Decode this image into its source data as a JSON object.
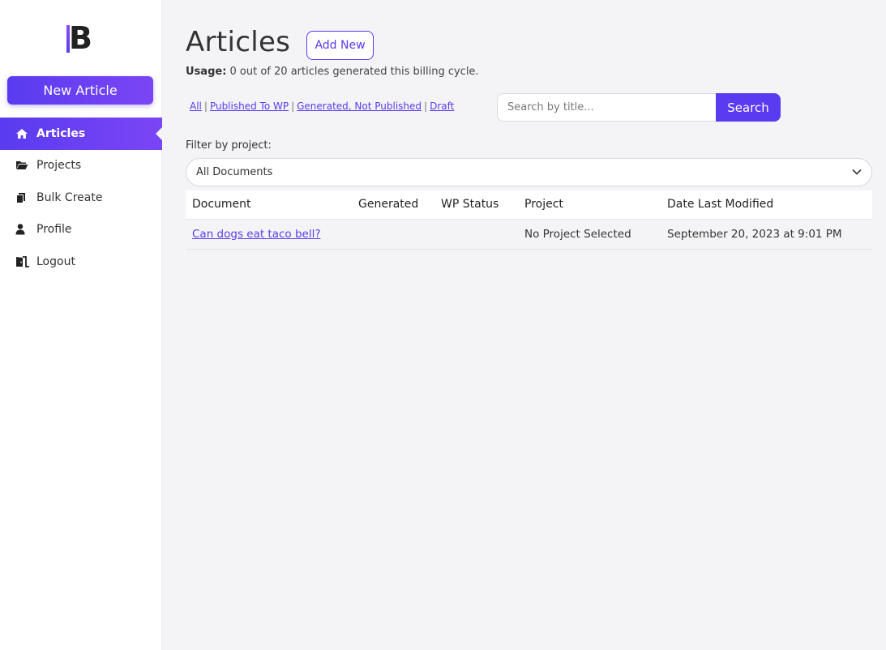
{
  "sidebar": {
    "logo_letter": "B",
    "new_article_label": "New Article",
    "items": [
      {
        "label": "Articles",
        "icon": "home-icon"
      },
      {
        "label": "Projects",
        "icon": "folder-icon"
      },
      {
        "label": "Bulk Create",
        "icon": "copy-icon"
      },
      {
        "label": "Profile",
        "icon": "user-icon"
      },
      {
        "label": "Logout",
        "icon": "door-icon"
      }
    ]
  },
  "main": {
    "title": "Articles",
    "add_new_label": "Add New",
    "usage_label": "Usage:",
    "usage_text": "0 out of 20 articles generated this billing cycle.",
    "filters": [
      "All",
      "Published To WP",
      "Generated, Not Published",
      "Draft"
    ],
    "search_placeholder": "Search by title...",
    "search_button_label": "Search",
    "filter_by_project_label": "Filter by project:",
    "project_select_value": "All Documents"
  },
  "table": {
    "columns": [
      "Document",
      "Generated",
      "WP Status",
      "Project",
      "Date Last Modified"
    ],
    "rows": [
      {
        "document": "Can dogs eat taco bell?",
        "generated": "",
        "wp_status": "",
        "project": "No Project Selected",
        "date_modified": "September 20, 2023 at 9:01 PM"
      }
    ]
  },
  "colors": {
    "accent": "#5a3bf0",
    "accent_gradient_end": "#7b45f5",
    "background": "#f4f4f6"
  }
}
